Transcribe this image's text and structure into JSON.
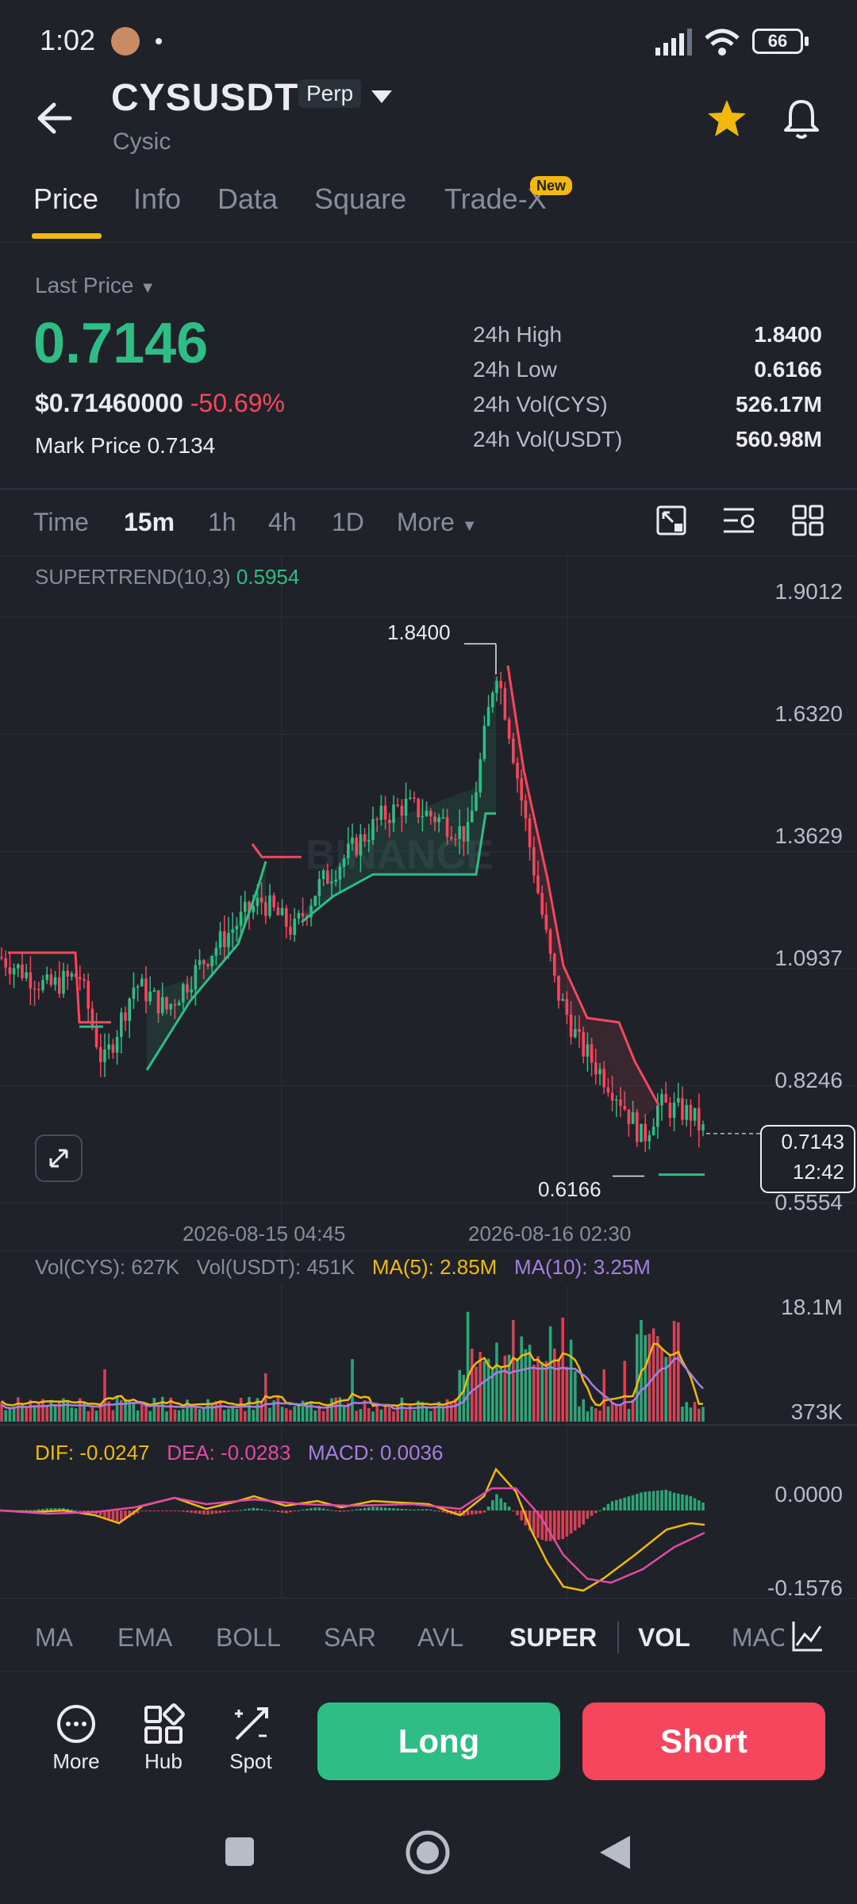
{
  "status_bar": {
    "time": "1:02",
    "battery": "66"
  },
  "header": {
    "symbol": "CYSUSDT",
    "badge": "Perp",
    "subtitle": "Cysic"
  },
  "tabs": [
    {
      "label": "Price",
      "active": true
    },
    {
      "label": "Info",
      "active": false
    },
    {
      "label": "Data",
      "active": false
    },
    {
      "label": "Square",
      "active": false
    },
    {
      "label": "Trade-X",
      "active": false
    }
  ],
  "new_badge": "New",
  "price": {
    "selector_label": "Last Price",
    "last": "0.7146",
    "usd": "$0.71460000",
    "change": "-50.69%",
    "mark_label": "Mark Price",
    "mark_value": "0.7134"
  },
  "stats": [
    {
      "label": "24h High",
      "value": "1.8400"
    },
    {
      "label": "24h Low",
      "value": "0.6166"
    },
    {
      "label": "24h Vol(CYS)",
      "value": "526.17M"
    },
    {
      "label": "24h Vol(USDT)",
      "value": "560.98M"
    }
  ],
  "timeframes": {
    "items": [
      "Time",
      "15m",
      "1h",
      "4h",
      "1D"
    ],
    "active": "15m",
    "more": "More"
  },
  "chart": {
    "indicator_name": "SUPERTREND(10,3)",
    "indicator_value": "0.5954",
    "y_ticks": [
      "1.9012",
      "1.6320",
      "1.3629",
      "1.0937",
      "0.8246",
      "0.5554"
    ],
    "high_label": "1.8400",
    "low_label": "0.6166",
    "current_price": "0.7143",
    "countdown": "12:42",
    "x_ticks": [
      "2026-08-15 04:45",
      "2026-08-16 02:30"
    ],
    "watermark": "BINANCE"
  },
  "volume": {
    "vol_cys": "Vol(CYS): 627K",
    "vol_usdt": "Vol(USDT): 451K",
    "ma5": "MA(5): 2.85M",
    "ma10": "MA(10): 3.25M",
    "y_top": "18.1M",
    "y_bottom": "373K"
  },
  "macd": {
    "dif": "DIF: -0.0247",
    "dea": "DEA: -0.0283",
    "macd": "MACD: 0.0036",
    "y_top": "0.0000",
    "y_bottom": "-0.1576"
  },
  "indicator_tabs": [
    {
      "label": "MA",
      "active": false
    },
    {
      "label": "EMA",
      "active": false
    },
    {
      "label": "BOLL",
      "active": false
    },
    {
      "label": "SAR",
      "active": false
    },
    {
      "label": "AVL",
      "active": false
    },
    {
      "label": "SUPER",
      "active": true
    },
    {
      "label": "VOL",
      "active": true
    },
    {
      "label": "MAC",
      "active": false
    }
  ],
  "actions": {
    "more": "More",
    "hub": "Hub",
    "spot": "Spot",
    "long": "Long",
    "short": "Short"
  },
  "colors": {
    "up": "#2ebd85",
    "down": "#f6465d",
    "accent": "#f0b90b",
    "ma5": "#f0b90b",
    "ma10": "#a77ee0",
    "dea": "#e04ba6"
  }
}
